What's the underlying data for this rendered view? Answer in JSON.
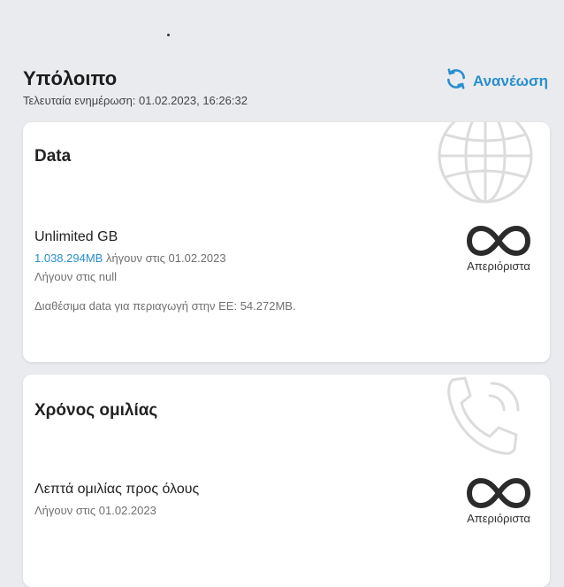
{
  "header": {
    "title": "Υπόλοιπο",
    "last_update": "Τελευταία ενημέρωση: 01.02.2023, 16:26:32",
    "refresh_label": "Ανανέωση"
  },
  "data_card": {
    "title": "Data",
    "plan_name": "Unlimited GB",
    "amount": "1.038.294MB",
    "expiry_text": " λήγουν στις 01.02.2023",
    "expiry_line2": "Λήγουν στις null",
    "roaming": "Διαθέσιμα data για περιαγωγή στην ΕΕ: 54.272MB.",
    "unlimited_label": "Απεριόριστα"
  },
  "voice_card": {
    "title": "Χρόνος ομιλίας",
    "plan_name": "Λεπτά ομιλίας προς όλους",
    "expiry": "Λήγουν στις 01.02.2023",
    "unlimited_label": "Απεριόριστα"
  },
  "icons": {
    "refresh": "refresh-icon",
    "globe": "globe-icon",
    "phone": "phone-icon",
    "infinity": "infinity-icon"
  },
  "colors": {
    "accent": "#2a8fcd",
    "background": "#e9ebee",
    "card": "#ffffff"
  }
}
